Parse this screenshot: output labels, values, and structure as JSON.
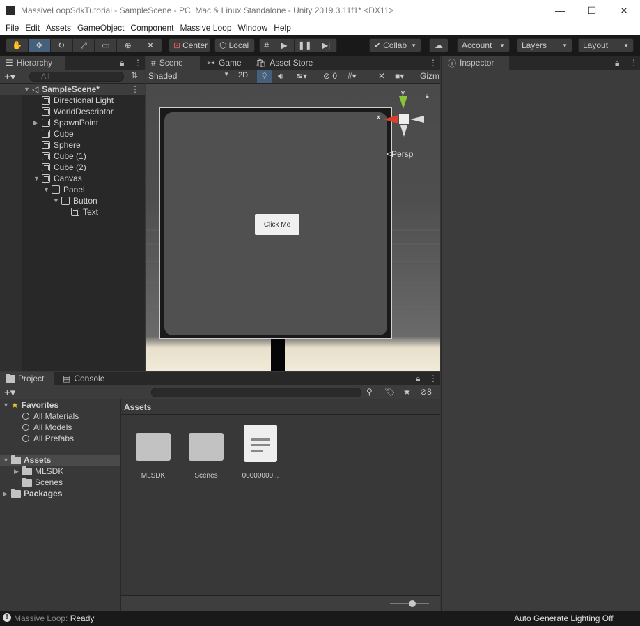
{
  "window": {
    "title": "MassiveLoopSdkTutorial - SampleScene - PC, Mac & Linux Standalone - Unity 2019.3.11f1* <DX11>",
    "minimize": "—",
    "maximize": "☐",
    "close": "✕"
  },
  "menu": [
    "File",
    "Edit",
    "Assets",
    "GameObject",
    "Component",
    "Massive Loop",
    "Window",
    "Help"
  ],
  "toolbar": {
    "center_label": "Center",
    "local_label": "Local",
    "collab_label": "Collab",
    "account_label": "Account",
    "layers_label": "Layers",
    "layout_label": "Layout"
  },
  "hierarchy": {
    "tab_label": "Hierarchy",
    "search_placeholder": "All",
    "scene_name": "SampleScene*",
    "items": [
      {
        "label": "Directional Light"
      },
      {
        "label": "WorldDescriptor"
      },
      {
        "label": "SpawnPoint"
      },
      {
        "label": "Cube"
      },
      {
        "label": "Sphere"
      },
      {
        "label": "Cube (1)"
      },
      {
        "label": "Cube (2)"
      },
      {
        "label": "Canvas"
      },
      {
        "label": "Panel"
      },
      {
        "label": "Button"
      },
      {
        "label": "Text"
      }
    ]
  },
  "scene": {
    "tabs": [
      "Scene",
      "Game",
      "Asset Store"
    ],
    "shading_mode": "Shaded",
    "mode_2d": "2D",
    "hidden_count": "0",
    "gizmos_label": "Gizm",
    "persp_label": "Persp",
    "axis_y": "y",
    "axis_x": "x",
    "button_text": "Click Me"
  },
  "inspector": {
    "tab_label": "Inspector"
  },
  "project": {
    "tabs": [
      "Project",
      "Console"
    ],
    "favorites_label": "Favorites",
    "favorites": [
      "All Materials",
      "All Models",
      "All Prefabs"
    ],
    "assets_label": "Assets",
    "asset_folders": [
      "MLSDK",
      "Scenes"
    ],
    "packages_label": "Packages",
    "breadcrumb": "Assets",
    "hidden_count": "8",
    "grid_items": [
      "MLSDK",
      "Scenes",
      "00000000..."
    ]
  },
  "status": {
    "prefix": "Massive Loop:",
    "state": "Ready",
    "right_text": "Auto Generate Lighting Off"
  },
  "colors": {
    "accent_selected": "#46607c",
    "window_bg": "#383838",
    "panel_bg": "#282828"
  }
}
